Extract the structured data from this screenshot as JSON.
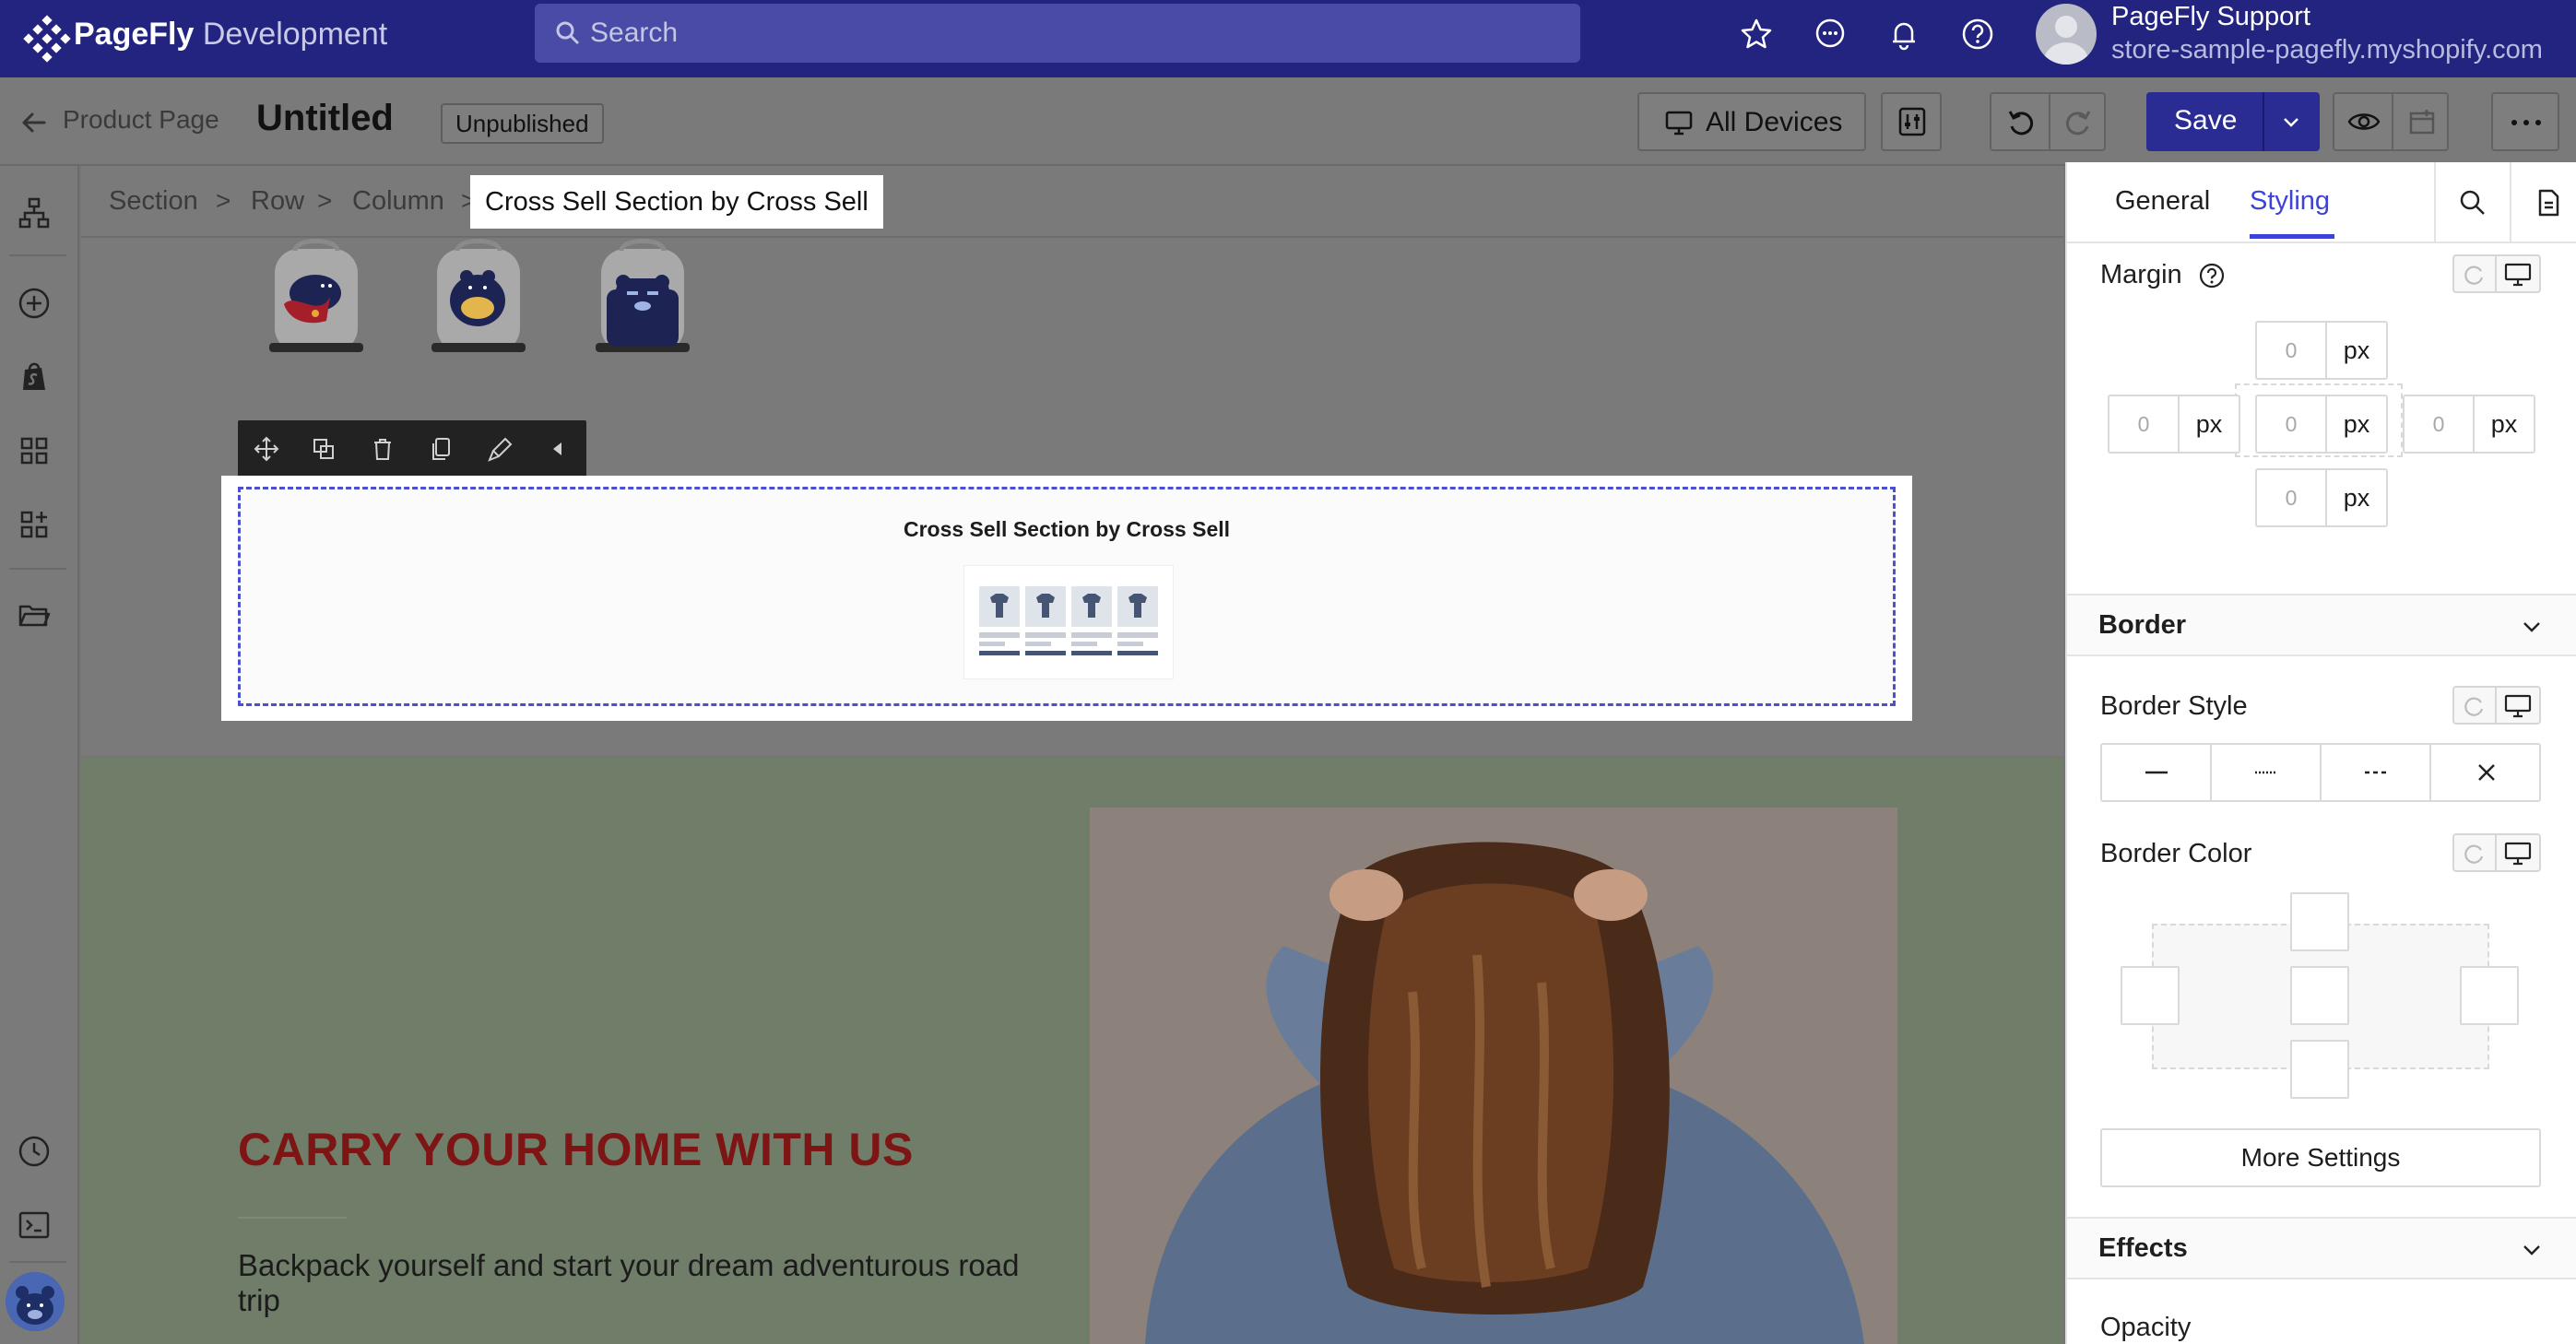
{
  "app": {
    "brand": "PageFly",
    "environment": "Development",
    "search_placeholder": "Search"
  },
  "user": {
    "name": "PageFly Support",
    "store": "store-sample-pagefly.myshopify.com"
  },
  "editor": {
    "back_label": "Product Page",
    "page_title": "Untitled",
    "status": "Unpublished",
    "devices_label": "All Devices",
    "save_label": "Save"
  },
  "breadcrumb": {
    "items": [
      "Section",
      "Row",
      "Column"
    ],
    "separator": ">",
    "active": "Cross Sell Section by Cross Sell"
  },
  "canvas": {
    "selected_element_title": "Cross Sell Section by Cross Sell",
    "hero_title": "CARRY YOUR HOME WITH US",
    "hero_text": "Backpack yourself and start your dream adventurous road trip"
  },
  "panel": {
    "tabs": [
      {
        "label": "General",
        "active": false
      },
      {
        "label": "Styling",
        "active": true
      }
    ],
    "margin": {
      "label": "Margin",
      "top": "0",
      "left": "0",
      "center": "0",
      "right": "0",
      "bottom": "0",
      "unit": "px"
    },
    "border": {
      "section_label": "Border",
      "style_label": "Border Style",
      "color_label": "Border Color",
      "more_settings": "More Settings"
    },
    "effects": {
      "section_label": "Effects",
      "opacity_label": "Opacity"
    }
  },
  "colors": {
    "topbar": "#23247f",
    "accent": "#3d43d6",
    "save_button": "#2a2c93",
    "hero_title": "#7e1515",
    "selection_outline": "#4b4fd0"
  }
}
